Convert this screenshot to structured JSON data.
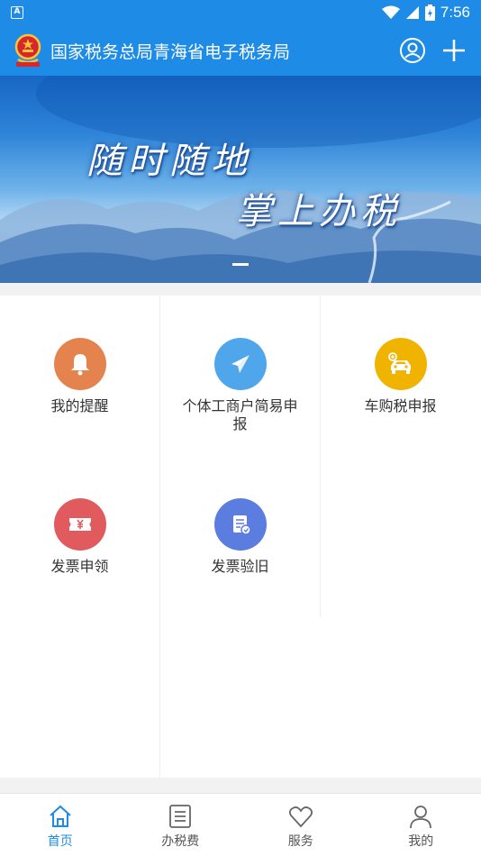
{
  "status_bar": {
    "notification_glyph": "A",
    "time": "7:56"
  },
  "header": {
    "title": "国家税务总局青海省电子税务局"
  },
  "banner": {
    "line1": "随时随地",
    "line2": "掌上办税"
  },
  "tiles": [
    {
      "label": "我的提醒",
      "icon": "bell-icon",
      "color": "#e4834d"
    },
    {
      "label": "个体工商户简易申报",
      "icon": "paper-plane-icon",
      "color": "#4fa6ea"
    },
    {
      "label": "车购税申报",
      "icon": "car-icon",
      "color": "#f0b400"
    },
    {
      "label": "发票申领",
      "icon": "ticket-yuan-icon",
      "color": "#e15a5e"
    },
    {
      "label": "发票验旧",
      "icon": "document-check-icon",
      "color": "#5b7de0"
    }
  ],
  "tabs": [
    {
      "label": "首页",
      "icon": "home-icon",
      "active": true
    },
    {
      "label": "办税费",
      "icon": "list-icon",
      "active": false
    },
    {
      "label": "服务",
      "icon": "heart-icon",
      "active": false
    },
    {
      "label": "我的",
      "icon": "person-icon",
      "active": false
    }
  ],
  "colors": {
    "primary": "#1e8ce6",
    "text": "#333333"
  }
}
